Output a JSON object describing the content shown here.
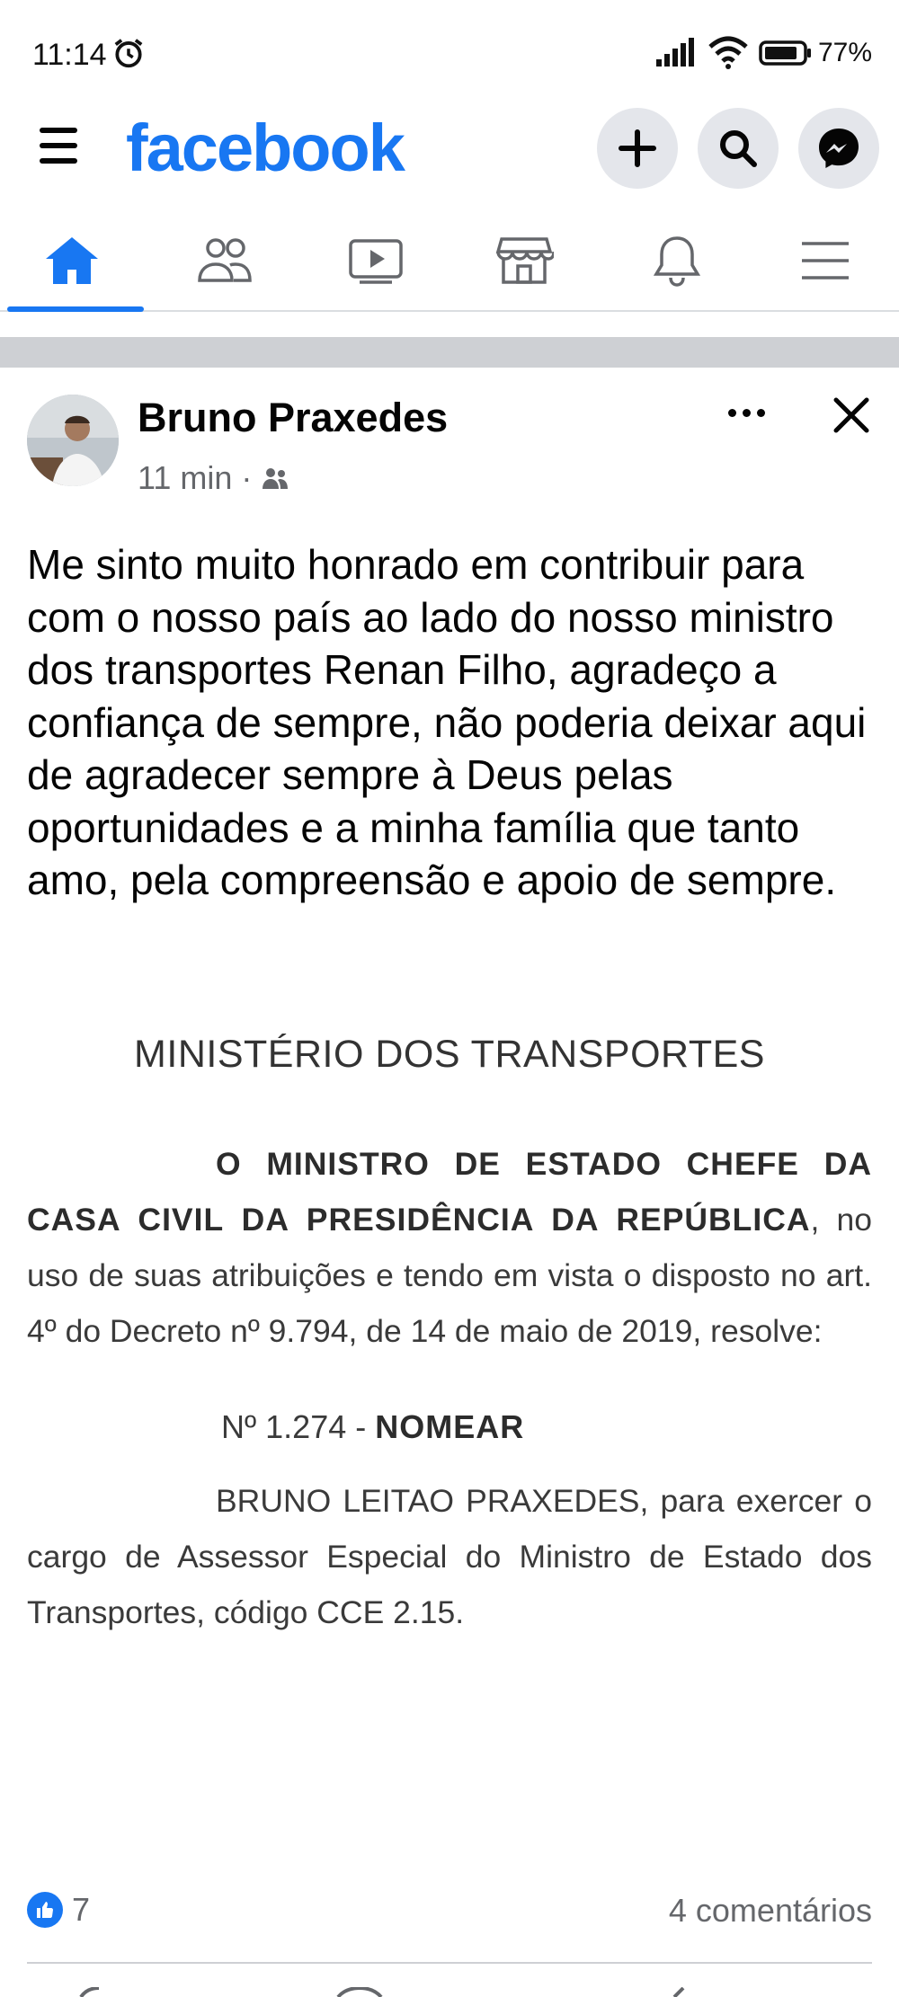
{
  "status_bar": {
    "time": "11:14",
    "battery": "77%",
    "icons": [
      "alarm-icon",
      "signal-icon",
      "wifi-icon",
      "battery-icon"
    ]
  },
  "header": {
    "logo": "facebook",
    "brand_color": "#1877f2",
    "buttons": [
      "plus-icon",
      "search-icon",
      "messenger-icon"
    ]
  },
  "tabs": [
    {
      "name": "home",
      "icon": "home-icon",
      "active": true
    },
    {
      "name": "friends",
      "icon": "friends-icon",
      "active": false
    },
    {
      "name": "watch",
      "icon": "video-icon",
      "active": false
    },
    {
      "name": "marketplace",
      "icon": "store-icon",
      "active": false
    },
    {
      "name": "notifications",
      "icon": "bell-icon",
      "active": false
    },
    {
      "name": "menu",
      "icon": "menu-icon",
      "active": false
    }
  ],
  "post": {
    "author": "Bruno Praxedes",
    "time": "11 min",
    "audience_icon": "friends-audience-icon",
    "text": "Me sinto muito honrado em contribuir para com o nosso país ao lado do nosso ministro dos transportes Renan Filho, agradeço a confiança de sempre, não poderia deixar aqui de agradecer sempre à Deus pelas oportunidades e a minha família que tanto amo, pela compreensão e apoio de sempre.",
    "image": {
      "title": "MINISTÉRIO DOS TRANSPORTES",
      "para1_bold": "O MINISTRO DE ESTADO CHEFE DA CASA CIVIL DA PRESIDÊNCIA DA REPÚBLICA",
      "para1_rest": ", no uso de suas atribuições e tendo em vista o disposto no art. 4º do Decreto nº 9.794, de 14 de maio de 2019, resolve:",
      "nomear_number": "Nº 1.274 - ",
      "nomear_word": "NOMEAR",
      "para2": "BRUNO LEITAO PRAXEDES, para exercer o cargo de Assessor Especial do Ministro de Estado dos Transportes, código CCE 2.15."
    },
    "likes": "7",
    "comments": "4 comentários"
  }
}
